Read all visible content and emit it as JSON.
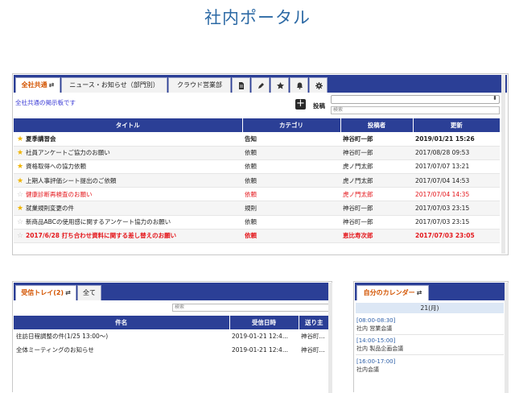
{
  "page": {
    "title": "社内ポータル"
  },
  "board": {
    "tabs": [
      {
        "label": "全社共通",
        "switch": "⇄"
      },
      {
        "label": "ニュース・お知らせ（部門別）"
      },
      {
        "label": "クラウド営業部"
      }
    ],
    "description": "全社共通の掲示板です",
    "post_label": "投稿",
    "search_placeholder": "検索",
    "columns": [
      "タイトル",
      "カテゴリ",
      "投稿者",
      "更新"
    ],
    "rows": [
      {
        "title": "夏季講習会",
        "category": "告知",
        "author": "神谷町一郎",
        "updated": "2019/01/21 15:26",
        "star": "on",
        "style": "bold"
      },
      {
        "title": "社員アンケートご協力のお願い",
        "category": "依頼",
        "author": "神谷町一郎",
        "updated": "2017/08/28 09:53",
        "star": "on",
        "style": ""
      },
      {
        "title": "資格取得への協力依頼",
        "category": "依頼",
        "author": "虎ノ門太郎",
        "updated": "2017/07/07 13:21",
        "star": "on",
        "style": ""
      },
      {
        "title": "上期人事評価シート提出のご依頼",
        "category": "依頼",
        "author": "虎ノ門太郎",
        "updated": "2017/07/04 14:53",
        "star": "on",
        "style": ""
      },
      {
        "title": "健康診断再検査のお願い",
        "category": "依頼",
        "author": "虎ノ門太郎",
        "updated": "2017/07/04 14:35",
        "star": "off",
        "style": "red"
      },
      {
        "title": "就業規則変更の件",
        "category": "規則",
        "author": "神谷町一郎",
        "updated": "2017/07/03 23:15",
        "star": "on",
        "style": ""
      },
      {
        "title": "新商品ABCの使用感に関するアンケート協力のお願い",
        "category": "依頼",
        "author": "神谷町一郎",
        "updated": "2017/07/03 23:15",
        "star": "off",
        "style": ""
      },
      {
        "title": "2017/6/28 打ち合わせ資料に関する差し替えのお願い",
        "category": "依頼",
        "author": "恵比寿次郎",
        "updated": "2017/07/03 23:05",
        "star": "off",
        "style": "red bold"
      }
    ]
  },
  "inbox": {
    "tabs": [
      {
        "label": "受信トレイ(2)",
        "switch": "⇄"
      },
      {
        "label": "全て"
      }
    ],
    "search_placeholder": "検索",
    "columns": [
      "件名",
      "受信日時",
      "送り主"
    ],
    "rows": [
      {
        "subject": "往訪日程調整の件(1/25 13:00〜)",
        "received": "2019-01-21 12:4...",
        "sender": "神谷町..."
      },
      {
        "subject": "全体ミーティングのお知らせ",
        "received": "2019-01-21 12:4...",
        "sender": "神谷町..."
      }
    ]
  },
  "calendar": {
    "tab": {
      "label": "自分のカレンダー",
      "switch": "⇄"
    },
    "day": "21(月)",
    "events": [
      {
        "time": "[08:00-08:30]",
        "title": "社内 営業会議"
      },
      {
        "time": "[14:00-15:00]",
        "title": "社内 製品企画会議"
      },
      {
        "time": "[16:00-17:00]",
        "title": "社内会議"
      }
    ]
  },
  "colors": {
    "header": "#2b3f96",
    "title": "#2d6aa5",
    "active_tab_text": "#d35400",
    "alert": "#e4161b",
    "star": "#f0b400"
  }
}
